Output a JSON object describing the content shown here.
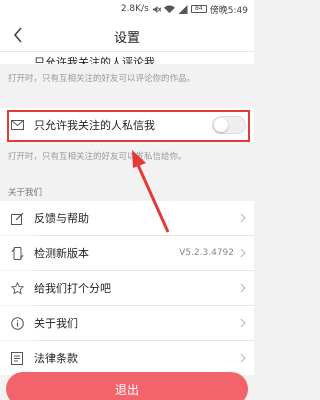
{
  "status_bar": {
    "speed": "2.8K/s",
    "battery": "84",
    "time": "傍晚5:49"
  },
  "nav": {
    "title": "设置"
  },
  "top_row": {
    "label": "只允许我关注的人评论我"
  },
  "hint_comments": "打开时，只有互相关注的好友可以评论你的作品。",
  "dm_row": {
    "label": "只允许我关注的人私信我",
    "enabled": false
  },
  "hint_dm": "打开时，只有互相关注的好友可以发私信给你。",
  "section_about": "关于我们",
  "menu": [
    {
      "label": "反馈与帮助",
      "value": "",
      "icon": "edit-icon"
    },
    {
      "label": "检测新版本",
      "value": "V5.2.3.4792",
      "icon": "refresh-phone-icon"
    },
    {
      "label": "给我们打个分吧",
      "value": "",
      "icon": "star-icon"
    },
    {
      "label": "关于我们",
      "value": "",
      "icon": "info-icon"
    },
    {
      "label": "法律条款",
      "value": "",
      "icon": "document-icon"
    }
  ],
  "logout": "退出",
  "colors": {
    "accent": "#f2636b",
    "highlight": "#e53935"
  }
}
